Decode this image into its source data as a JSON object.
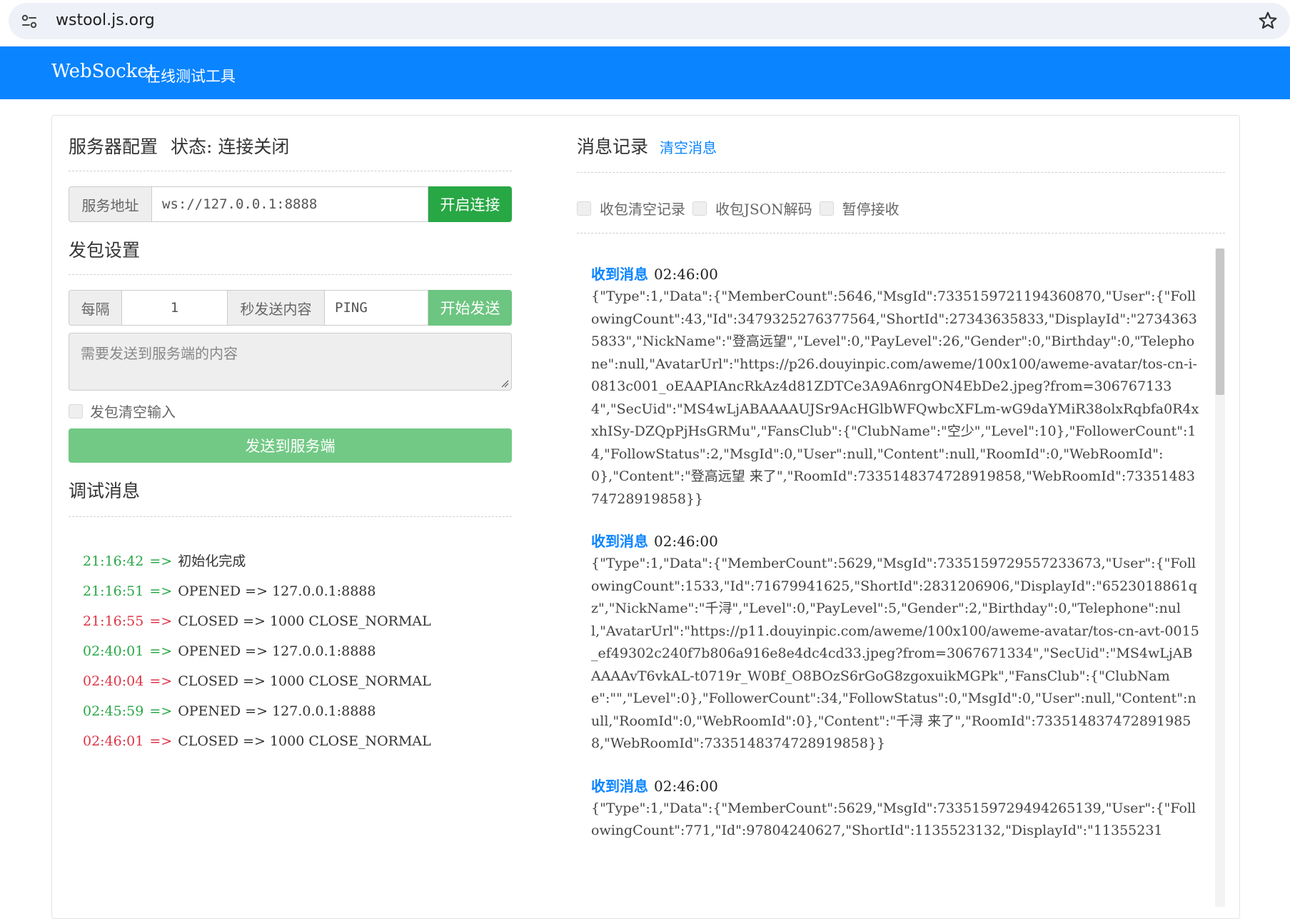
{
  "browser": {
    "url": "wstool.js.org"
  },
  "header": {
    "logo": "WebSocket",
    "subtitle": "在线测试工具"
  },
  "server": {
    "title": "服务器配置",
    "status": "状态: 连接关闭",
    "address_label": "服务地址",
    "address_value": "ws://127.0.0.1:8888",
    "connect_label": "开启连接"
  },
  "send_settings": {
    "title": "发包设置",
    "interval_label": "每隔",
    "interval_value": "1",
    "content_label": "秒发送内容",
    "content_value": "PING",
    "start_label": "开始发送",
    "textarea_placeholder": "需要发送到服务端的内容",
    "clear_input_label": "发包清空输入",
    "send_button_label": "发送到服务端"
  },
  "debug": {
    "title": "调试消息",
    "lines": [
      {
        "time": "21:16:42",
        "status": "ok",
        "text": "初始化完成"
      },
      {
        "time": "21:16:51",
        "status": "ok",
        "text": "OPENED => 127.0.0.1:8888"
      },
      {
        "time": "21:16:55",
        "status": "err",
        "text": "CLOSED => 1000 CLOSE_NORMAL"
      },
      {
        "time": "02:40:01",
        "status": "ok",
        "text": "OPENED => 127.0.0.1:8888"
      },
      {
        "time": "02:40:04",
        "status": "err",
        "text": "CLOSED => 1000 CLOSE_NORMAL"
      },
      {
        "time": "02:45:59",
        "status": "ok",
        "text": "OPENED => 127.0.0.1:8888"
      },
      {
        "time": "02:46:01",
        "status": "err",
        "text": "CLOSED => 1000 CLOSE_NORMAL"
      }
    ],
    "arrow": "=>"
  },
  "messages": {
    "title": "消息记录",
    "clear_label": "清空消息",
    "options": [
      "收包清空记录",
      "收包JSON解码",
      "暂停接收"
    ],
    "received_label": "收到消息",
    "items": [
      {
        "time": "02:46:00",
        "body": "{\"Type\":1,\"Data\":{\"MemberCount\":5646,\"MsgId\":7335159721194360870,\"User\":{\"FollowingCount\":43,\"Id\":3479325276377564,\"ShortId\":27343635833,\"DisplayId\":\"27343635833\",\"NickName\":\"登高远望\",\"Level\":0,\"PayLevel\":26,\"Gender\":0,\"Birthday\":0,\"Telephone\":null,\"AvatarUrl\":\"https://p26.douyinpic.com/aweme/100x100/aweme-avatar/tos-cn-i-0813c001_oEAAPIAncRkAz4d81ZDTCe3A9A6nrgON4EbDe2.jpeg?from=3067671334\",\"SecUid\":\"MS4wLjABAAAAUJSr9AcHGlbWFQwbcXFLm-wG9daYMiR38olxRqbfa0R4xxhISy-DZQpPjHsGRMu\",\"FansClub\":{\"ClubName\":\"空少\",\"Level\":10},\"FollowerCount\":14,\"FollowStatus\":2,\"MsgId\":0,\"User\":null,\"Content\":null,\"RoomId\":0,\"WebRoomId\":0},\"Content\":\"登高远望 来了\",\"RoomId\":7335148374728919858,\"WebRoomId\":7335148374728919858}}"
      },
      {
        "time": "02:46:00",
        "body": "{\"Type\":1,\"Data\":{\"MemberCount\":5629,\"MsgId\":7335159729557233673,\"User\":{\"FollowingCount\":1533,\"Id\":71679941625,\"ShortId\":2831206906,\"DisplayId\":\"6523018861qz\",\"NickName\":\"千浔\",\"Level\":0,\"PayLevel\":5,\"Gender\":2,\"Birthday\":0,\"Telephone\":null,\"AvatarUrl\":\"https://p11.douyinpic.com/aweme/100x100/aweme-avatar/tos-cn-avt-0015_ef49302c240f7b806a916e8e4dc4cd33.jpeg?from=3067671334\",\"SecUid\":\"MS4wLjABAAAAvT6vkAL-t0719r_W0Bf_O8BOzS6rGoG8zgoxuikMGPk\",\"FansClub\":{\"ClubName\":\"\",\"Level\":0},\"FollowerCount\":34,\"FollowStatus\":0,\"MsgId\":0,\"User\":null,\"Content\":null,\"RoomId\":0,\"WebRoomId\":0},\"Content\":\"千浔 来了\",\"RoomId\":7335148374728919858,\"WebRoomId\":7335148374728919858}}"
      },
      {
        "time": "02:46:00",
        "body": "{\"Type\":1,\"Data\":{\"MemberCount\":5629,\"MsgId\":7335159729494265139,\"User\":{\"FollowingCount\":771,\"Id\":97804240627,\"ShortId\":1135523132,\"DisplayId\":\"11355231"
      }
    ]
  },
  "colors": {
    "primary": "#0a84ff",
    "success": "#28a745",
    "danger": "#dc3545"
  }
}
